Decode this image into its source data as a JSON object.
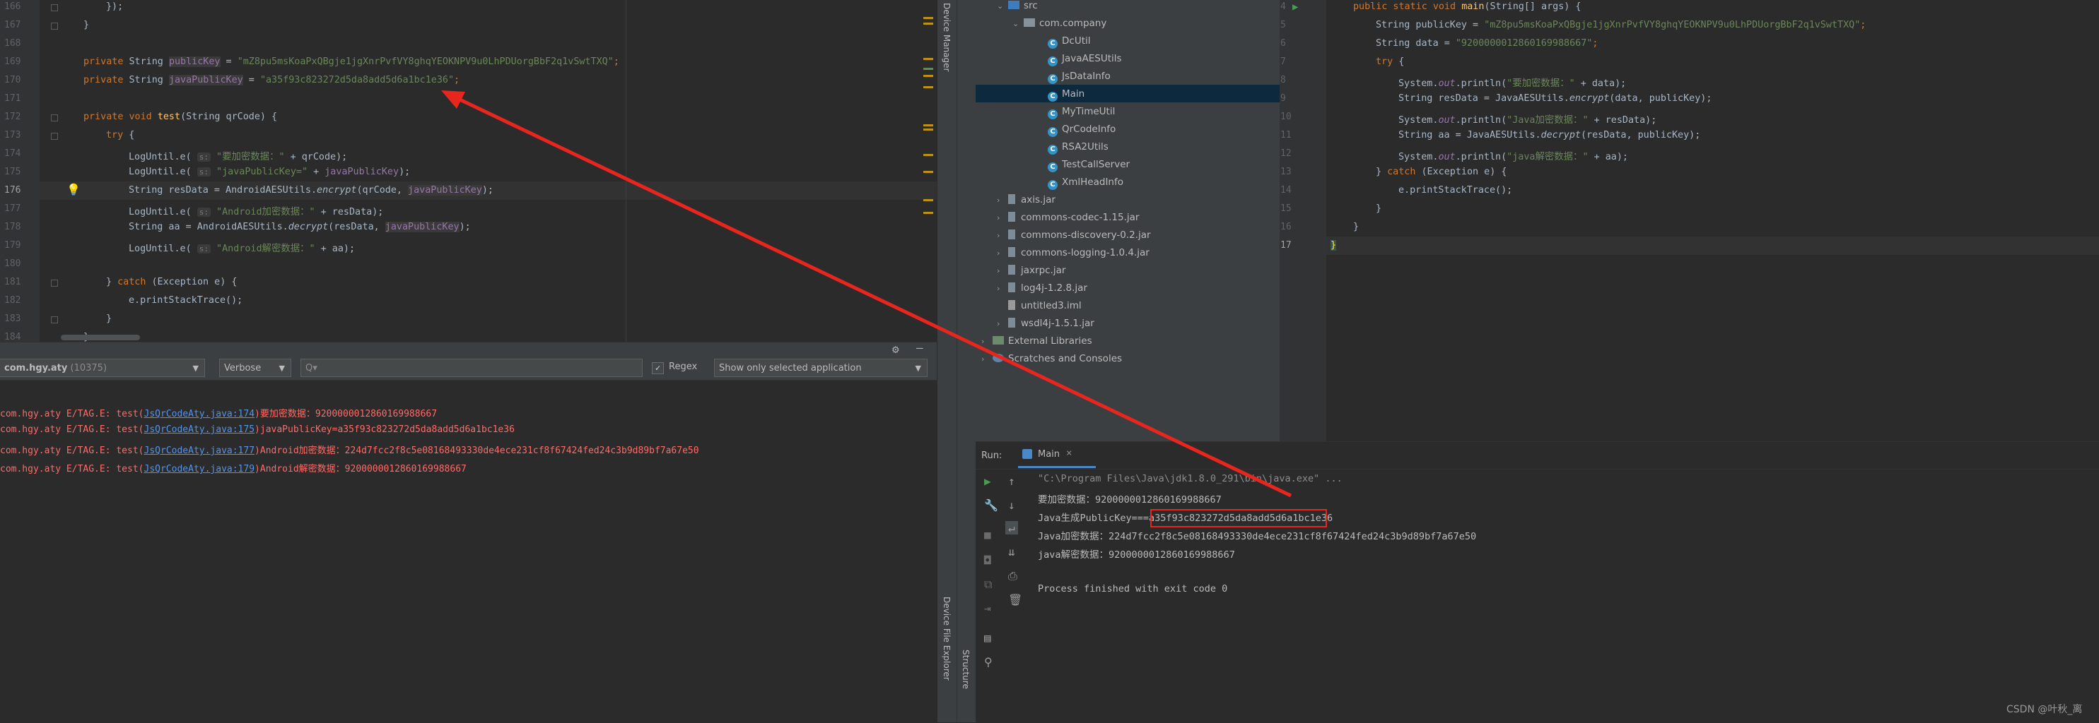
{
  "left_editor": {
    "lines": [
      {
        "n": "166",
        "text": "        });"
      },
      {
        "n": "167",
        "text": "    }"
      },
      {
        "n": "168",
        "text": ""
      },
      {
        "n": "169",
        "text": "private String publicKey = \"mZ8pu5msKoaPxQBgje1jgXnrPvfVY8ghqYEOKNPV9u0LhPDUorgBbF2q1vSwtTXQ\";"
      },
      {
        "n": "170",
        "text": "private String javaPublicKey = \"a35f93c823272d5da8add5d6a1bc1e36\";"
      },
      {
        "n": "171",
        "text": ""
      },
      {
        "n": "172",
        "text": "private void test(String qrCode) {"
      },
      {
        "n": "173",
        "text": "    try {"
      },
      {
        "n": "174",
        "text": "        LogUntil.e( s: \"要加密数据：\" + qrCode);"
      },
      {
        "n": "175",
        "text": "        LogUntil.e( s: \"javaPublicKey=\" + javaPublicKey);"
      },
      {
        "n": "176",
        "text": "        String resData = AndroidAESUtils.encrypt(qrCode, javaPublicKey);"
      },
      {
        "n": "177",
        "text": "        LogUntil.e( s: \"Android加密数据：\" + resData);"
      },
      {
        "n": "178",
        "text": "        String aa = AndroidAESUtils.decrypt(resData, javaPublicKey);"
      },
      {
        "n": "179",
        "text": "        LogUntil.e( s: \"Android解密数据：\" + aa);"
      },
      {
        "n": "180",
        "text": ""
      },
      {
        "n": "181",
        "text": "    } catch (Exception e) {"
      },
      {
        "n": "182",
        "text": "        e.printStackTrace();"
      },
      {
        "n": "183",
        "text": "    }"
      },
      {
        "n": "184",
        "text": "}"
      }
    ],
    "parts": {
      "l169_kw": "private",
      "l169_type": " String ",
      "l169_field": "publicKey",
      "l169_eq": " = ",
      "l169_str": "\"mZ8pu5msKoaPxQBgje1jgXnrPvfVY8ghqYEOKNPV9u0LhPDUorgBbF2q1vSwtTXQ\"",
      "l169_end": ";",
      "l170_kw": "private",
      "l170_type": " String ",
      "l170_field": "javaPublicKey",
      "l170_eq": " = ",
      "l170_str": "\"a35f93c823272d5da8add5d6a1bc1e36\"",
      "l170_end": ";",
      "l172_kw": "private void ",
      "l172_fn": "test",
      "l172_rest": "(String qrCode) {",
      "l173_kw": "try",
      "l173_rest": " {",
      "l174_a": "LogUntil.e( ",
      "l174_hint": "s:",
      "l174_str": " \"要加密数据：\"",
      "l174_rest": " + qrCode);",
      "l175_a": "LogUntil.e( ",
      "l175_hint": "s:",
      "l175_str": " \"javaPublicKey=\"",
      "l175_b": " + ",
      "l175_field": "javaPublicKey",
      "l175_rest": ");",
      "l176_a": "String resData = AndroidAESUtils.",
      "l176_it": "encrypt",
      "l176_b": "(qrCode, ",
      "l176_field": "javaPublicKey",
      "l176_rest": ");",
      "l177_a": "LogUntil.e( ",
      "l177_hint": "s:",
      "l177_str": " \"Android加密数据：\"",
      "l177_rest": " + resData);",
      "l178_a": "String aa = AndroidAESUtils.",
      "l178_it": "decrypt",
      "l178_b": "(resData, ",
      "l178_field": "javaPublicKey",
      "l178_rest": ");",
      "l179_a": "LogUntil.e( ",
      "l179_hint": "s:",
      "l179_str": " \"Android解密数据：\"",
      "l179_rest": " + aa);",
      "l181_a": "} ",
      "l181_kw": "catch",
      "l181_rest": " (Exception e) {",
      "l182": "e.printStackTrace();",
      "l183": "}",
      "l166": "});",
      "l167": "}",
      "l184": "}"
    }
  },
  "logcat": {
    "process": "com.hgy.aty",
    "pid": "(10375)",
    "level": "Verbose",
    "search_placeholder": "Q▾",
    "regex_label": "Regex",
    "filter": "Show only selected application",
    "lines": [
      {
        "prefix": "com.hgy.aty E/TAG.E: test(",
        "link": "JsQrCodeAty.java:174",
        "msg": ")要加密数据：92000000128601699886​67"
      },
      {
        "prefix": "com.hgy.aty E/TAG.E: test(",
        "link": "JsQrCodeAty.java:175",
        "msg": ")javaPublicKey=a35f93c823272d5da8add5d6a1bc1e36"
      },
      {
        "prefix": "com.hgy.aty E/TAG.E: test(",
        "link": "JsQrCodeAty.java:177",
        "msg": ")Android加密数据：224d7fcc2f8c5e08168493330de4ece231cf8f67424fed24c3b9d89bf7a67e50"
      },
      {
        "prefix": "com.hgy.aty E/TAG.E: test(",
        "link": "JsQrCodeAty.java:179",
        "msg": ")Android解密数据：9200000012860169988667"
      }
    ]
  },
  "side_strip": {
    "device_manager": "Device Manager",
    "device_file_explorer": "Device File Explorer",
    "structure": "Structure"
  },
  "project_tree": {
    "items": [
      {
        "label": "src",
        "kind": "folder"
      },
      {
        "label": "com.company",
        "kind": "package"
      },
      {
        "label": "DcUtil",
        "kind": "class"
      },
      {
        "label": "JavaAESUtils",
        "kind": "class"
      },
      {
        "label": "JsDataInfo",
        "kind": "class"
      },
      {
        "label": "Main",
        "kind": "class"
      },
      {
        "label": "MyTimeUtil",
        "kind": "class"
      },
      {
        "label": "QrCodeInfo",
        "kind": "class"
      },
      {
        "label": "RSA2Utils",
        "kind": "class"
      },
      {
        "label": "TestCallServer",
        "kind": "class"
      },
      {
        "label": "XmlHeadInfo",
        "kind": "class"
      },
      {
        "label": "axis.jar",
        "kind": "jar"
      },
      {
        "label": "commons-codec-1.15.jar",
        "kind": "jar"
      },
      {
        "label": "commons-discovery-0.2.jar",
        "kind": "jar"
      },
      {
        "label": "commons-logging-1.0.4.jar",
        "kind": "jar"
      },
      {
        "label": "jaxrpc.jar",
        "kind": "jar"
      },
      {
        "label": "log4j-1.2.8.jar",
        "kind": "jar"
      },
      {
        "label": "untitled3.iml",
        "kind": "file"
      },
      {
        "label": "wsdl4j-1.5.1.jar",
        "kind": "jar"
      },
      {
        "label": "External Libraries",
        "kind": "lib"
      },
      {
        "label": "Scratches and Consoles",
        "kind": "scratch"
      }
    ]
  },
  "right_editor": {
    "line_numbers": [
      "4",
      "5",
      "6",
      "7",
      "8",
      "9",
      "10",
      "11",
      "12",
      "13",
      "14",
      "15",
      "16",
      "17"
    ],
    "p": {
      "l4_kw": "public static void ",
      "l4_fn": "main",
      "l4_rest": "(String[] args) {",
      "l5_a": "String publicKey = ",
      "l5_str": "\"mZ8pu5msKoaPxQBgje1jgXnrPvfVY8ghqYEOKNPV9u0LhPDUorgBbF2q1vSwtTXQ\"",
      "l5_end": ";",
      "l6_a": "String data = ",
      "l6_str": "\"9200000012860169988667\"",
      "l6_end": ";",
      "l7_kw": "try",
      "l7_rest": " {",
      "l8_a": "System.",
      "l8_fld": "out",
      "l8_b": ".println(",
      "l8_str": "\"要加密数据：\"",
      "l8_rest": " + data);",
      "l9_a": "String resData = JavaAESUtils.",
      "l9_it": "encrypt",
      "l9_rest": "(data, publicKey);",
      "l10_a": "System.",
      "l10_fld": "out",
      "l10_b": ".println(",
      "l10_str": "\"Java加密数据：\"",
      "l10_rest": " + resData);",
      "l11_a": "String aa = JavaAESUtils.",
      "l11_it": "decrypt",
      "l11_rest": "(resData, publicKey);",
      "l12_a": "System.",
      "l12_fld": "out",
      "l12_b": ".println(",
      "l12_str": "\"java解密数据：\"",
      "l12_rest": " + aa);",
      "l13_a": "} ",
      "l13_kw": "catch",
      "l13_rest": " (Exception e) {",
      "l14": "e.printStackTrace();",
      "l15": "}",
      "l16": "}",
      "l17": "}"
    }
  },
  "run_panel": {
    "run_label": "Run:",
    "tab_label": "Main",
    "tab_close": "×",
    "output": [
      "\"C:\\Program Files\\Java\\jdk1.8.0_291\\bin\\java.exe\" ...",
      "要加密数据：9200000012860169988667",
      "Java生成PublicKey===",
      "Java加密数据：224d7fcc2f8c5e08168493330de4ece231cf8f67424fed24c3b9d89bf7a67e50",
      "java解密数据：9200000012860169988667",
      "",
      "Process finished with exit code 0"
    ],
    "highlighted_key": "a35f93c823272d5da8add5d6a1bc1e36"
  },
  "watermark": "CSDN @叶秋_离",
  "colors": {
    "annotation_red": "#e8261e",
    "editor_bg": "#2b2b2b",
    "panel_bg": "#3c3f41",
    "selection": "#0d293e"
  }
}
